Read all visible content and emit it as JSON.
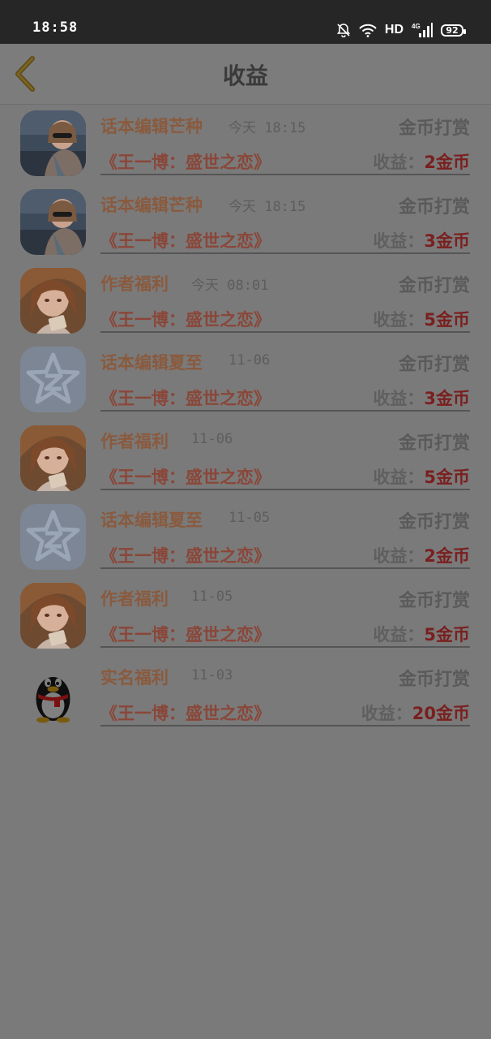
{
  "status_bar": {
    "time": "18:58",
    "network": "HD",
    "cell": "4G",
    "battery": "92"
  },
  "header": {
    "title": "收益"
  },
  "rows": [
    {
      "name": "话本编辑芒种",
      "time": "今天 18:15",
      "type": "金币打赏",
      "book": "《王一博：盛世之恋》",
      "earn_label": "收益：",
      "amount": "2",
      "unit": "金币",
      "avatar": "girl-photo"
    },
    {
      "name": "话本编辑芒种",
      "time": "今天 18:15",
      "type": "金币打赏",
      "book": "《王一博：盛世之恋》",
      "earn_label": "收益：",
      "amount": "3",
      "unit": "金币",
      "avatar": "girl-photo"
    },
    {
      "name": "作者福利",
      "time": "今天 08:01",
      "type": "金币打赏",
      "book": "《王一博：盛世之恋》",
      "earn_label": "收益：",
      "amount": "5",
      "unit": "金币",
      "avatar": "anime-girl"
    },
    {
      "name": "话本编辑夏至",
      "time": "11-06",
      "type": "金币打赏",
      "book": "《王一博：盛世之恋》",
      "earn_label": "收益：",
      "amount": "3",
      "unit": "金币",
      "avatar": "qzone-star"
    },
    {
      "name": "作者福利",
      "time": "11-06",
      "type": "金币打赏",
      "book": "《王一博：盛世之恋》",
      "earn_label": "收益：",
      "amount": "5",
      "unit": "金币",
      "avatar": "anime-girl"
    },
    {
      "name": "话本编辑夏至",
      "time": "11-05",
      "type": "金币打赏",
      "book": "《王一博：盛世之恋》",
      "earn_label": "收益：",
      "amount": "2",
      "unit": "金币",
      "avatar": "qzone-star"
    },
    {
      "name": "作者福利",
      "time": "11-05",
      "type": "金币打赏",
      "book": "《王一博：盛世之恋》",
      "earn_label": "收益：",
      "amount": "5",
      "unit": "金币",
      "avatar": "anime-girl"
    },
    {
      "name": "实名福利",
      "time": "11-03",
      "type": "金币打赏",
      "book": "《王一博：盛世之恋》",
      "earn_label": "收益：",
      "amount": "20",
      "unit": "金币",
      "avatar": "qq-penguin"
    }
  ]
}
